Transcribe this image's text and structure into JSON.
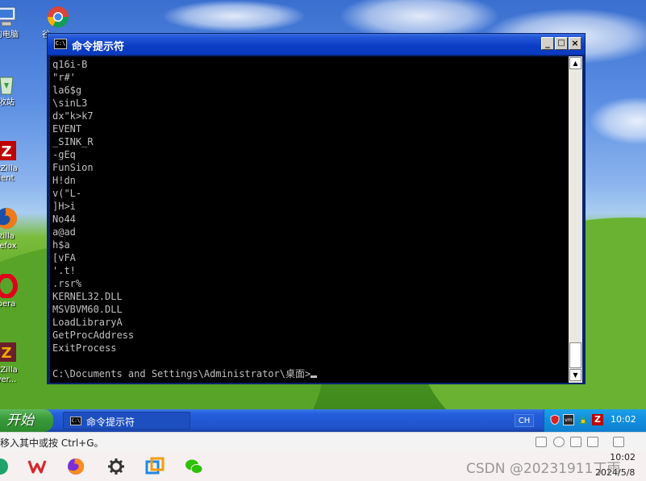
{
  "desktop": {
    "icons": [
      {
        "label": "的电脑",
        "icon": "my-computer-icon"
      },
      {
        "label": "收站",
        "icon": "recycle-bin-icon"
      },
      {
        "label": "eZilla",
        "label2": "ient",
        "icon": "filezilla-client-icon"
      },
      {
        "label": "zilla",
        "label2": "refox",
        "icon": "firefox-icon"
      },
      {
        "label": "pera",
        "icon": "opera-icon"
      },
      {
        "label": "eZilla",
        "label2": "ver...",
        "icon": "filezilla-server-icon"
      }
    ],
    "chrome_icon_label": "谷"
  },
  "cmd_window": {
    "title": "命令提示符",
    "icon_text": "C:\\",
    "controls": {
      "minimize": "_",
      "maximize": "□",
      "close": "×"
    },
    "lines": [
      "q16i-B",
      "\"r#'",
      "la6$g",
      "\\sinL3",
      "dx\"k>k7",
      "EVENT",
      "_SINK_R",
      "-gEq",
      "FunSion",
      "H!dn",
      "v(\"L-",
      "]H>i",
      "No44",
      "a@ad",
      "h$a",
      "[vFA",
      "'.t!",
      ".rsr%",
      "KERNEL32.DLL",
      "MSVBVM60.DLL",
      "LoadLibraryA",
      "GetProcAddress",
      "ExitProcess"
    ],
    "prompt": "C:\\Documents and Settings\\Administrator\\桌面>",
    "scroll_up": "▲",
    "scroll_down": "▼"
  },
  "taskbar": {
    "start_label": "开始",
    "task_label": "命令提示符",
    "language": "CH",
    "clock": "10:02"
  },
  "host_status": {
    "message": "移入其中或按 Ctrl+G。"
  },
  "host_taskbar": {
    "time": "10:02",
    "date": "2024/5/8"
  },
  "watermark": "CSDN @20231911丁雨"
}
